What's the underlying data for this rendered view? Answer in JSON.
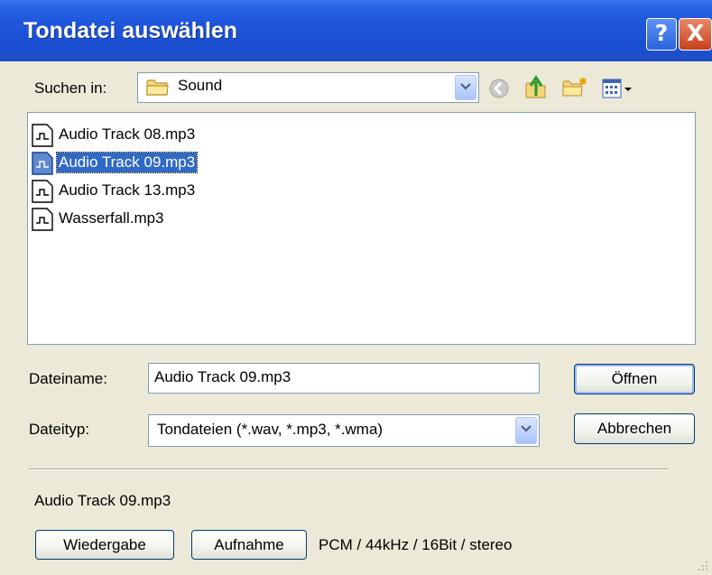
{
  "window": {
    "title": "Tondatei auswählen"
  },
  "titlebar_buttons": {
    "help_label": "?",
    "close_label": "X"
  },
  "look_in": {
    "label": "Suchen in:",
    "value": "Sound"
  },
  "files": [
    {
      "name": "Audio Track 08.mp3",
      "selected": false
    },
    {
      "name": "Audio Track 09.mp3",
      "selected": true
    },
    {
      "name": "Audio Track 13.mp3",
      "selected": false
    },
    {
      "name": "Wasserfall.mp3",
      "selected": false
    }
  ],
  "filename": {
    "label": "Dateiname:",
    "value": "Audio Track 09.mp3"
  },
  "filetype": {
    "label": "Dateityp:",
    "value": "Tondateien (*.wav, *.mp3, *.wma)"
  },
  "buttons": {
    "open": "Öffnen",
    "cancel": "Abbrechen",
    "play": "Wiedergabe",
    "record": "Aufnahme"
  },
  "preview": {
    "selected_name": "Audio Track 09.mp3",
    "format": "PCM / 44kHz / 16Bit / stereo"
  },
  "colors": {
    "titlebar": "#1f57dc",
    "dialog_face": "#ece9d8",
    "selection": "#316ac5",
    "close_button": "#c8401c"
  },
  "icons": {
    "folder": "folder-icon",
    "back": "back-icon",
    "up": "up-folder-icon",
    "new_folder": "new-folder-icon",
    "view_menu": "view-menu-icon",
    "audio_file": "audio-file-icon"
  }
}
